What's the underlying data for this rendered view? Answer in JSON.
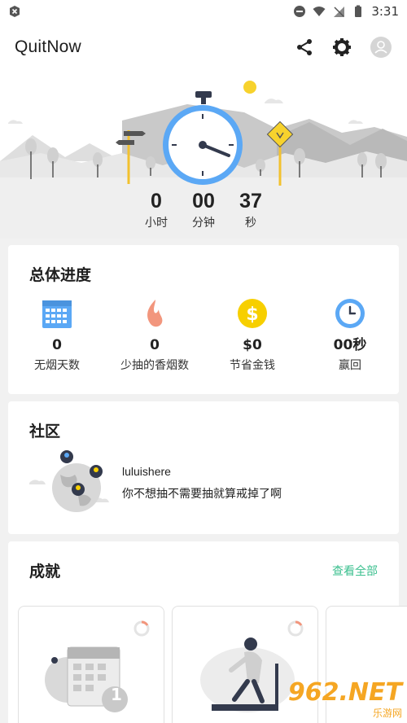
{
  "status_bar": {
    "time": "3:31"
  },
  "app_bar": {
    "title": "QuitNow",
    "share_icon": "share-icon",
    "settings_icon": "gear-icon",
    "avatar_icon": "avatar-icon"
  },
  "timer": {
    "hours": "0",
    "hours_label": "小时",
    "minutes": "00",
    "minutes_label": "分钟",
    "seconds": "37",
    "seconds_label": "秒"
  },
  "progress": {
    "title": "总体进度",
    "stats": [
      {
        "value": "0",
        "label": "无烟天数",
        "icon": "calendar-icon"
      },
      {
        "value": "0",
        "label": "少抽的香烟数",
        "icon": "flame-icon"
      },
      {
        "value": "$0",
        "label": "节省金钱",
        "icon": "dollar-coin-icon"
      },
      {
        "value": "00秒",
        "label": "赢回",
        "icon": "clock-icon"
      }
    ]
  },
  "community": {
    "title": "社区",
    "post_user": "luluishere",
    "post_text": "你不想抽不需要抽就算戒掉了啊"
  },
  "achievements": {
    "title": "成就",
    "view_all": "查看全部",
    "badge_number": "1"
  },
  "watermark": {
    "text": "962.NET",
    "subtext": "乐游网"
  },
  "colors": {
    "accent_blue": "#5ba8f5",
    "accent_green": "#3cc08f",
    "coin_yellow": "#f7cf00",
    "flame": "#f2967d"
  }
}
